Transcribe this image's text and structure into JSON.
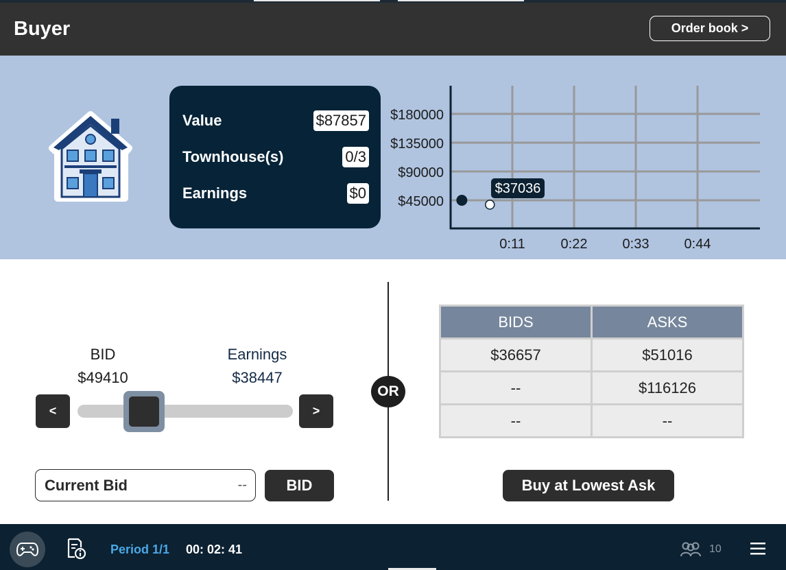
{
  "header": {
    "title": "Buyer",
    "order_book_label": "Order book >"
  },
  "asset": {
    "icon": "house-icon",
    "rows": [
      {
        "label": "Value",
        "value": "$87857"
      },
      {
        "label": "Townhouse(s)",
        "value": "0/3"
      },
      {
        "label": "Earnings",
        "value": "$0"
      }
    ]
  },
  "chart_data": {
    "type": "scatter",
    "y_ticks": [
      "$180000",
      "$135000",
      "$90000",
      "$45000"
    ],
    "x_ticks": [
      "0:11",
      "0:22",
      "0:33",
      "0:44"
    ],
    "grid": true,
    "series": [
      {
        "points": [
          {
            "x": "0:02",
            "y": 45000
          }
        ],
        "style": "filled"
      },
      {
        "points": [
          {
            "x": "0:07",
            "y": 37036
          }
        ],
        "style": "hollow",
        "label": "$37036"
      }
    ]
  },
  "bid_panel": {
    "bid_label": "BID",
    "bid_value": "$49410",
    "earnings_label": "Earnings",
    "earnings_value": "$38447",
    "dec_label": "<",
    "inc_label": ">",
    "current_bid_label": "Current Bid",
    "current_bid_value": "--",
    "bid_button_label": "BID"
  },
  "or_label": "OR",
  "book": {
    "headers": [
      "BIDS",
      "ASKS"
    ],
    "rows": [
      [
        "$36657",
        "$51016"
      ],
      [
        "--",
        "$116126"
      ],
      [
        "--",
        "--"
      ]
    ],
    "buy_button_label": "Buy at Lowest Ask"
  },
  "footer": {
    "period": "Period 1/1",
    "timer": "00: 02: 41",
    "users_count": "10",
    "icons": [
      "gamepad-icon",
      "document-info-icon",
      "users-icon",
      "menu-icon"
    ]
  }
}
